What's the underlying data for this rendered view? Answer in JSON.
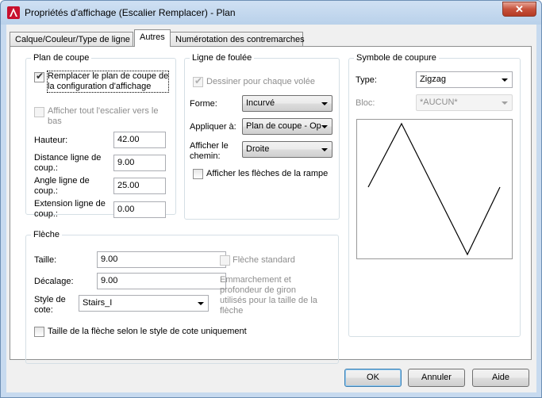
{
  "window": {
    "title": "Propriétés d'affichage (Escalier Remplacer) - Plan",
    "close_glyph": "✕"
  },
  "tabs": [
    {
      "label": "Calque/Couleur/Type de ligne",
      "active": false
    },
    {
      "label": "Autres",
      "active": true
    },
    {
      "label": "Numérotation des contremarches",
      "active": false
    }
  ],
  "plan_de_coupe": {
    "title": "Plan de coupe",
    "replace_checkbox": {
      "label_line1": "Remplacer le plan de coupe de",
      "label_line2": "la configuration d'affichage",
      "checked": true
    },
    "show_all_checkbox": {
      "label_line1": "Afficher tout l'escalier vers le",
      "label_line2": "bas",
      "checked": false,
      "enabled": false
    },
    "hauteur": {
      "label": "Hauteur:",
      "value": "42.00"
    },
    "distance": {
      "label_line1": "Distance ligne de",
      "label_line2": "coup.:",
      "value": "9.00"
    },
    "angle": {
      "label_line1": "Angle ligne de",
      "label_line2": "coup.:",
      "value": "25.00"
    },
    "extension": {
      "label_line1": "Extension ligne de",
      "label_line2": "coup.:",
      "value": "0.00"
    }
  },
  "ligne_foulee": {
    "title": "Ligne de foulée",
    "draw_each_checkbox": {
      "label": "Dessiner pour chaque volée",
      "checked": true,
      "enabled": false
    },
    "forme": {
      "label": "Forme:",
      "value": "Incurvé"
    },
    "appliquer": {
      "label": "Appliquer à:",
      "value": "Plan de coupe - Op"
    },
    "afficher_chemin": {
      "label_line1": "Afficher le",
      "label_line2": "chemin:",
      "value": "Droite"
    },
    "arrows_checkbox": {
      "label": "Afficher les flèches de la rampe",
      "checked": false
    }
  },
  "symbole": {
    "title": "Symbole de coupure",
    "type": {
      "label": "Type:",
      "value": "Zigzag"
    },
    "bloc": {
      "label": "Bloc:",
      "value": "*AUCUN*"
    }
  },
  "fleche": {
    "title": "Flèche",
    "taille": {
      "label": "Taille:",
      "value": "9.00"
    },
    "decalage": {
      "label": "Décalage:",
      "value": "9.00"
    },
    "style_cote": {
      "label_line1": "Style de",
      "label_line2": "cote:",
      "value": "Stairs_I"
    },
    "standard_checkbox": {
      "label": "Flèche standard",
      "checked": false,
      "enabled": false
    },
    "info": [
      "Emmarchement et",
      "profondeur de giron",
      "utilisés pour la taille de la",
      "flèche"
    ],
    "size_by_style_checkbox": {
      "label": "Taille de la flèche selon le style de cote uniquement",
      "checked": false
    }
  },
  "buttons": {
    "ok": "OK",
    "cancel": "Annuler",
    "help": "Aide"
  },
  "colors": {
    "title_bar": "#b9d1ea",
    "close_button": "#c7523c",
    "dialog_bg": "#f0f0f0"
  }
}
